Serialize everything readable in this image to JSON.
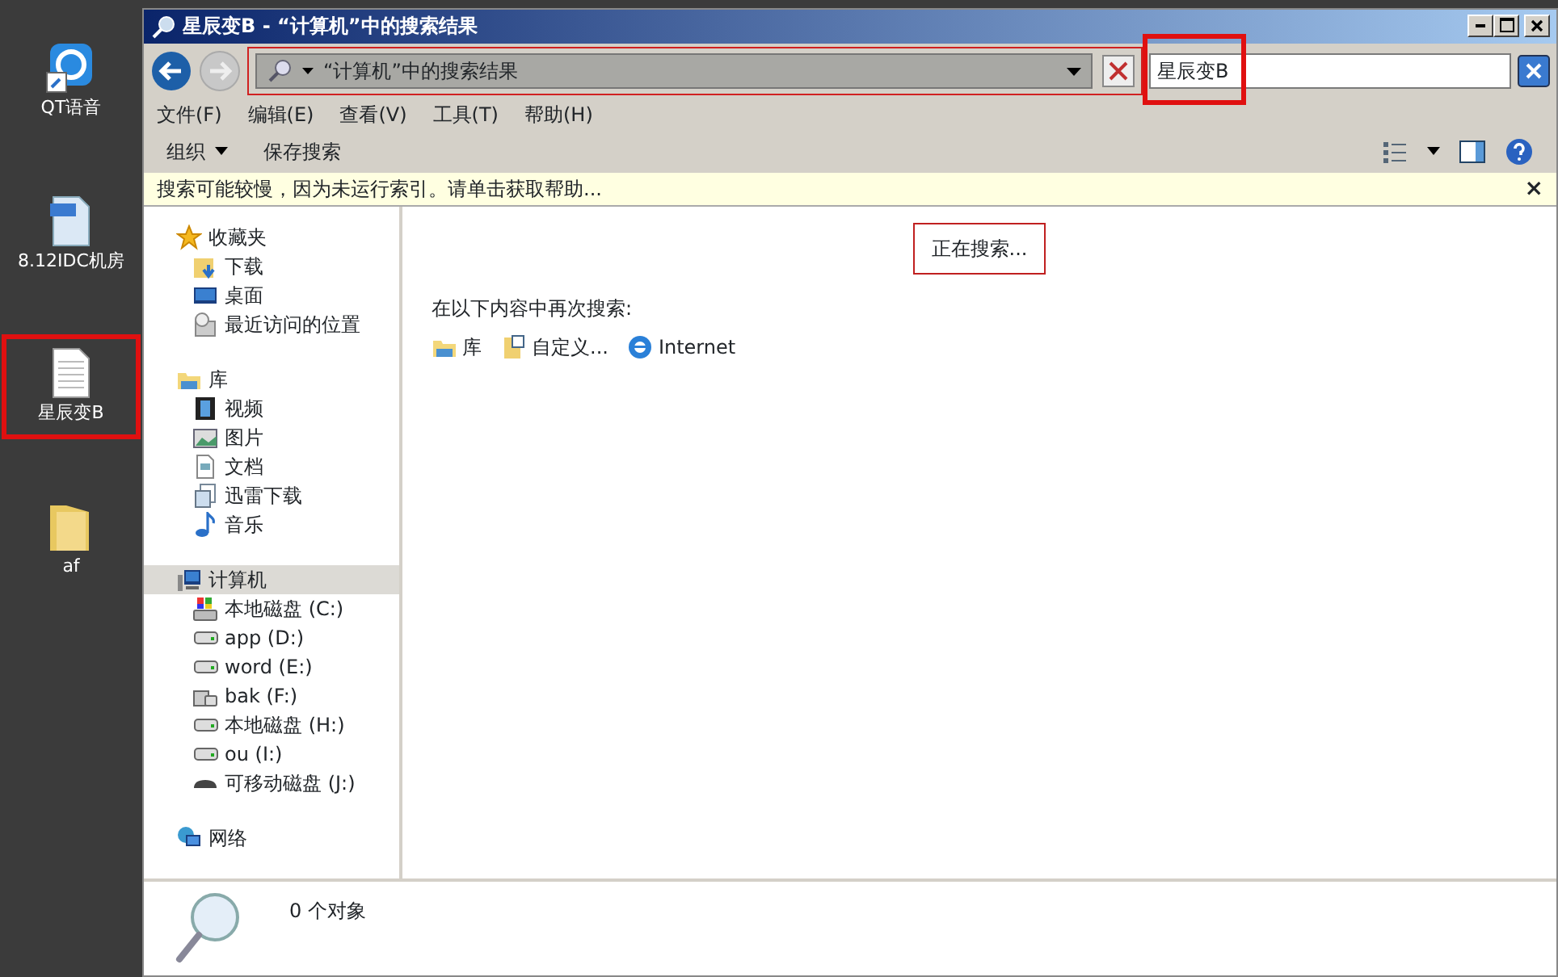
{
  "desktop": {
    "icons": [
      {
        "label": "QT语音",
        "highlighted": false
      },
      {
        "label": "8.12IDC机房",
        "highlighted": false
      },
      {
        "label": "星辰变B",
        "highlighted": true
      },
      {
        "label": "af",
        "highlighted": false
      }
    ]
  },
  "window": {
    "title": "星辰变B - “计算机”中的搜索结果"
  },
  "address_bar": {
    "path": "“计算机”中的搜索结果",
    "highlighted": true
  },
  "search": {
    "value": "星辰变B",
    "highlighted": true
  },
  "menu": [
    "文件(F)",
    "编辑(E)",
    "查看(V)",
    "工具(T)",
    "帮助(H)"
  ],
  "command_bar": {
    "organize": "组织",
    "save_search": "保存搜索"
  },
  "info_bar": {
    "text": "搜索可能较慢，因为未运行索引。请单击获取帮助...",
    "close": "×"
  },
  "nav_pane": [
    {
      "label": "收藏夹",
      "selected": false,
      "children": [
        {
          "label": "下载",
          "selected": false
        },
        {
          "label": "桌面",
          "selected": false
        },
        {
          "label": "最近访问的位置",
          "selected": false
        }
      ]
    },
    {
      "label": "库",
      "selected": false,
      "children": [
        {
          "label": "视频",
          "selected": false
        },
        {
          "label": "图片",
          "selected": false
        },
        {
          "label": "文档",
          "selected": false
        },
        {
          "label": "迅雷下载",
          "selected": false
        },
        {
          "label": "音乐",
          "selected": false
        }
      ]
    },
    {
      "label": "计算机",
      "selected": true,
      "children": [
        {
          "label": "本地磁盘 (C:)",
          "selected": false
        },
        {
          "label": "app (D:)",
          "selected": false
        },
        {
          "label": "word (E:)",
          "selected": false
        },
        {
          "label": "bak (F:)",
          "selected": false
        },
        {
          "label": "本地磁盘 (H:)",
          "selected": false
        },
        {
          "label": "ou (I:)",
          "selected": false
        },
        {
          "label": "可移动磁盘 (J:)",
          "selected": false
        }
      ]
    },
    {
      "label": "网络",
      "selected": false
    }
  ],
  "content": {
    "status": "正在搜索...",
    "status_highlighted": true,
    "search_again_label": "在以下内容中再次搜索:",
    "search_again": [
      "库",
      "自定义...",
      "Internet"
    ]
  },
  "status_bar": {
    "count": "0 个对象"
  }
}
